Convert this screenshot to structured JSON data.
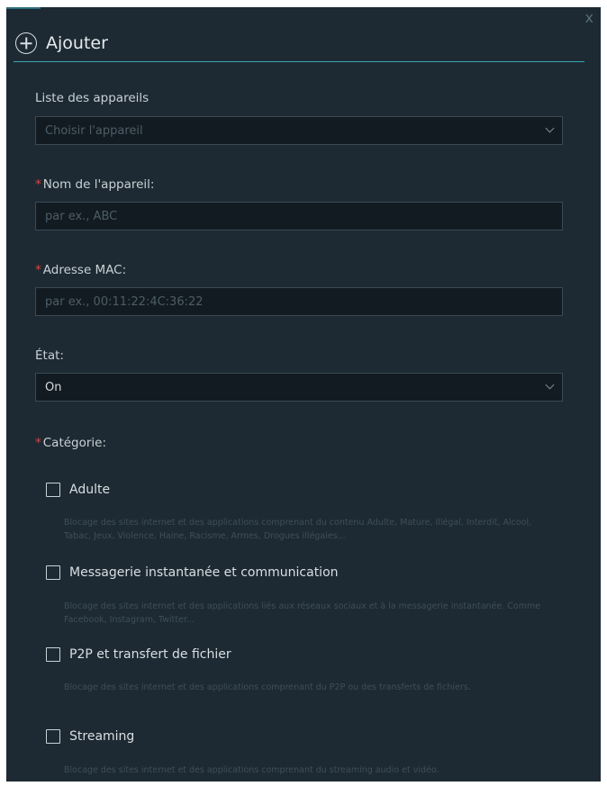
{
  "header": {
    "title": "Ajouter",
    "close": "x"
  },
  "device_list": {
    "label": "Liste des appareils",
    "placeholder": "Choisir l'appareil"
  },
  "device_name": {
    "label": "Nom de l'appareil:",
    "placeholder": "par ex., ABC"
  },
  "mac": {
    "label": "Adresse MAC:",
    "placeholder": "par ex., 00:11:22:4C:36:22"
  },
  "state": {
    "label": "État:",
    "value": "On"
  },
  "category": {
    "label": "Catégorie:",
    "items": [
      {
        "label": "Adulte",
        "description": "Blocage des sites internet et des applications comprenant du contenu Adulte, Mature, Illégal, Interdit, Alcool, Tabac, Jeux, Violence, Haine, Racisme, Armes, Drogues illégales..."
      },
      {
        "label": "Messagerie instantanée et communication",
        "description": "Blocage des sites internet et des applications liés aux réseaux sociaux et à la messagerie instantanée. Comme Facebook, Instagram, Twitter..."
      },
      {
        "label": "P2P et transfert de fichier",
        "description": "Blocage des sites internet et des applications comprenant du P2P ou des transferts de fichiers."
      },
      {
        "label": "Streaming",
        "description": "Blocage des sites internet et des applications comprenant du streaming audio et vidéo."
      }
    ]
  },
  "colors": {
    "background": "#1d2a33",
    "accent": "#3aa5b4",
    "required": "#d94444"
  }
}
